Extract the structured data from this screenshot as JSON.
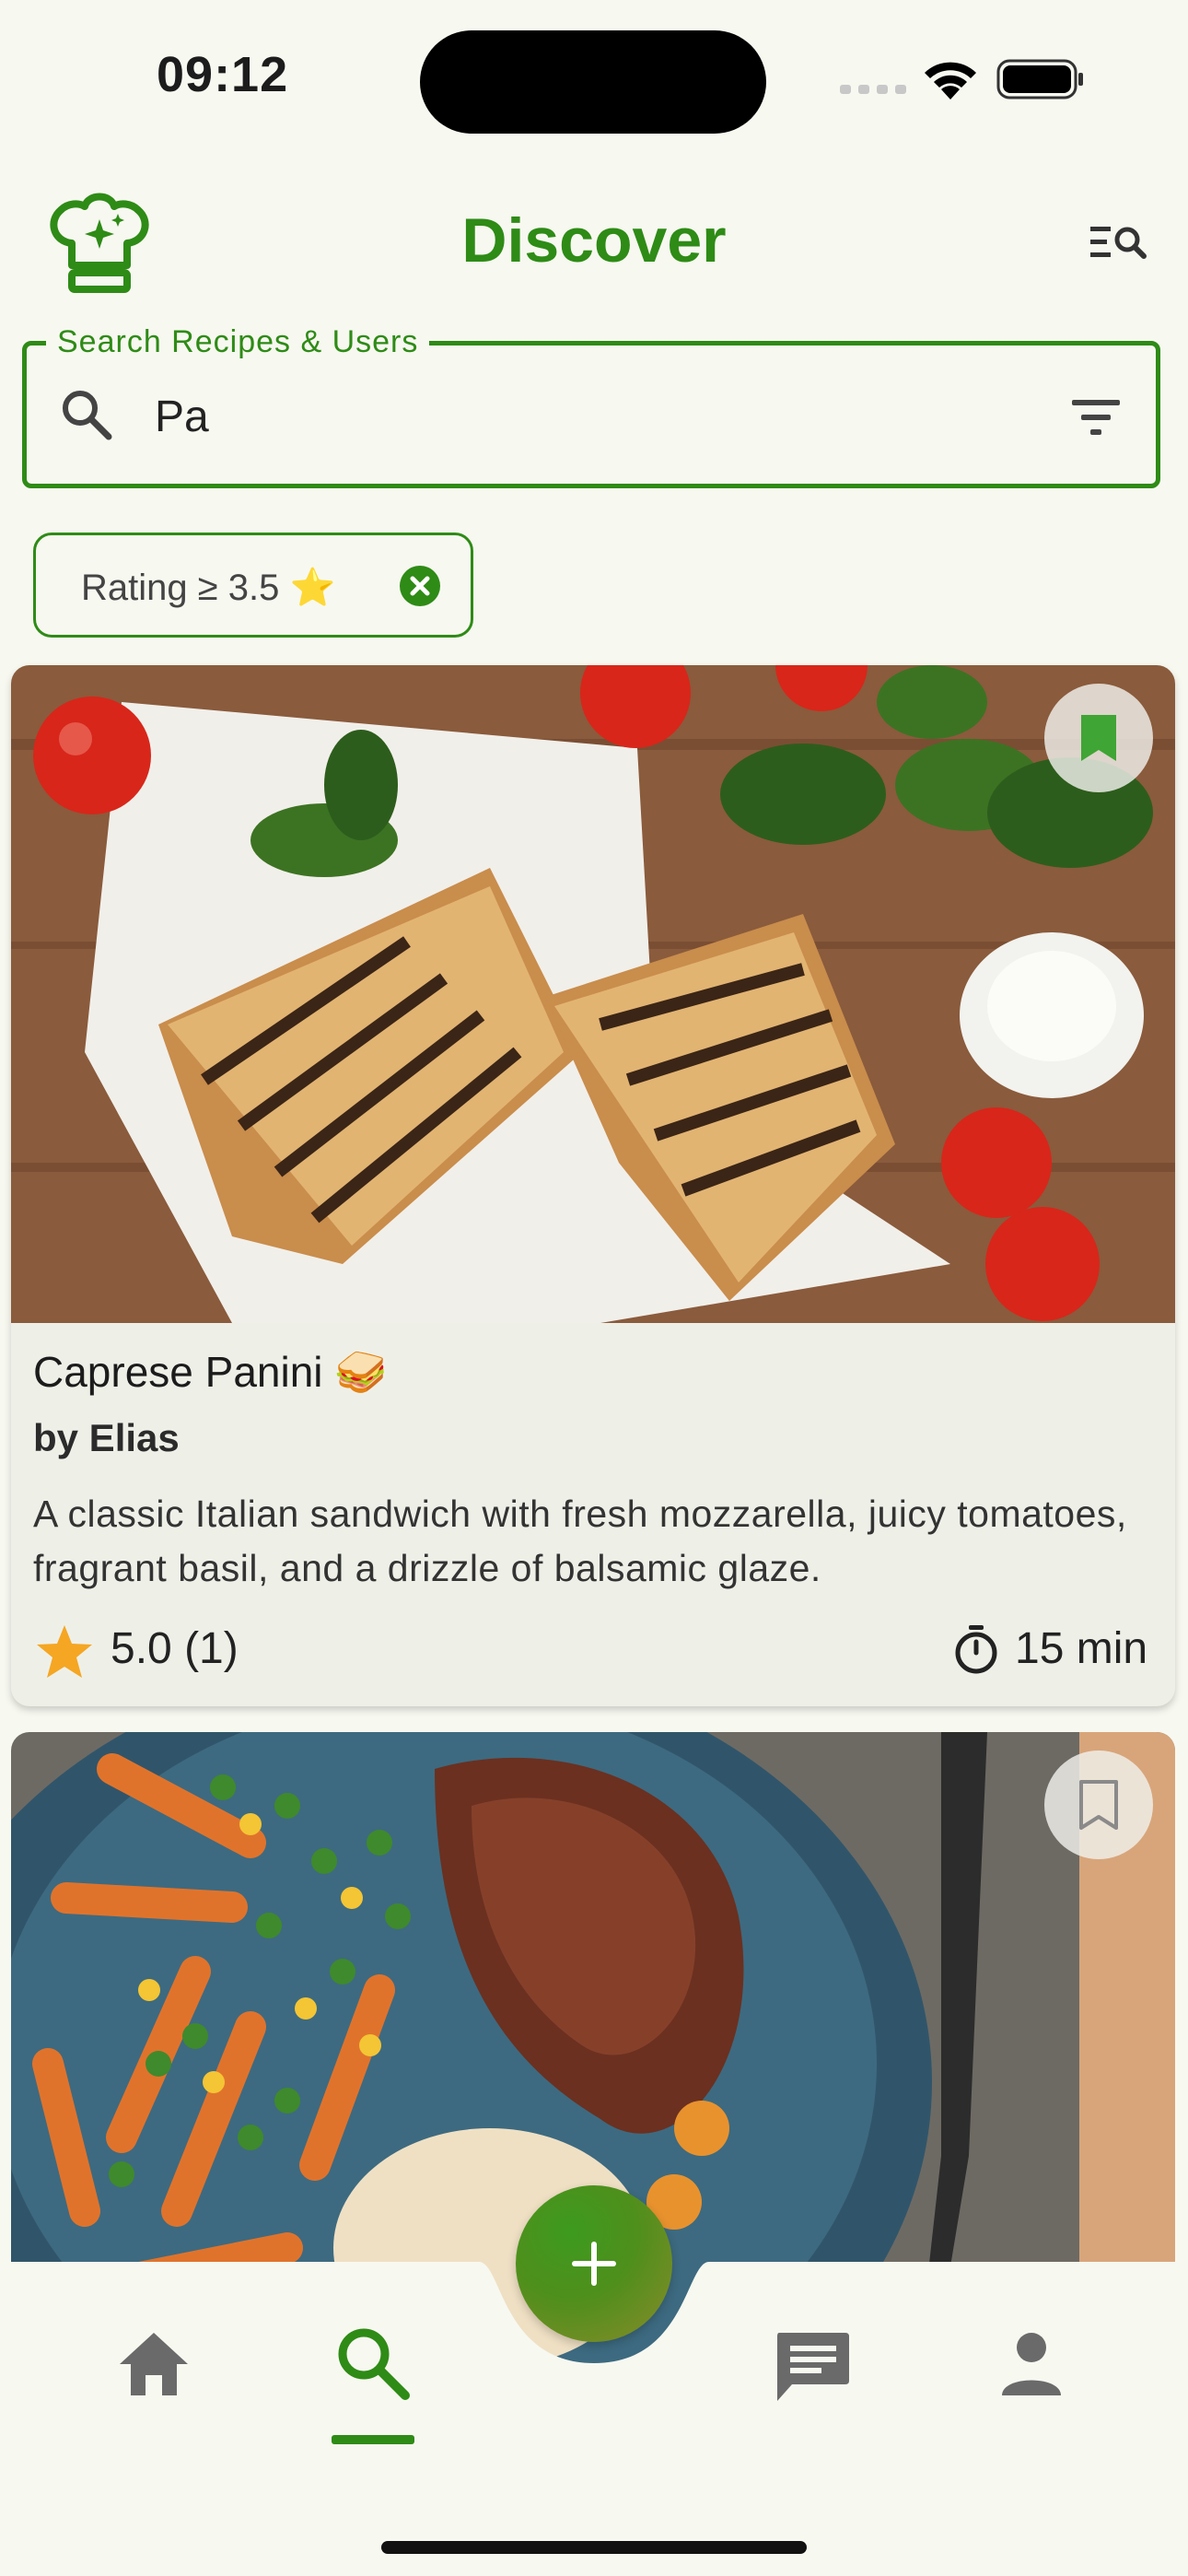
{
  "status_bar": {
    "time": "09:12"
  },
  "header": {
    "title": "Discover"
  },
  "search": {
    "label": "Search Recipes & Users",
    "value": "Pa"
  },
  "filters": [
    {
      "label": "Rating ≥ 3.5 ⭐"
    }
  ],
  "recipes": [
    {
      "title": "Caprese Panini 🥪",
      "author": "by Elias",
      "description": "A classic Italian sandwich with fresh mozzarella, juicy tomatoes, fragrant basil, and a drizzle of balsamic glaze.",
      "rating": "5.0 (1)",
      "time": "15 min",
      "bookmarked": true
    },
    {
      "bookmarked": false
    }
  ],
  "bottom_nav": {
    "items": [
      "home-icon",
      "search-icon",
      "add-icon",
      "chat-icon",
      "profile-icon"
    ],
    "active": "search-icon"
  },
  "colors": {
    "accent": "#2e8b16",
    "background": "#f7f8f0",
    "star": "#f5a623"
  }
}
